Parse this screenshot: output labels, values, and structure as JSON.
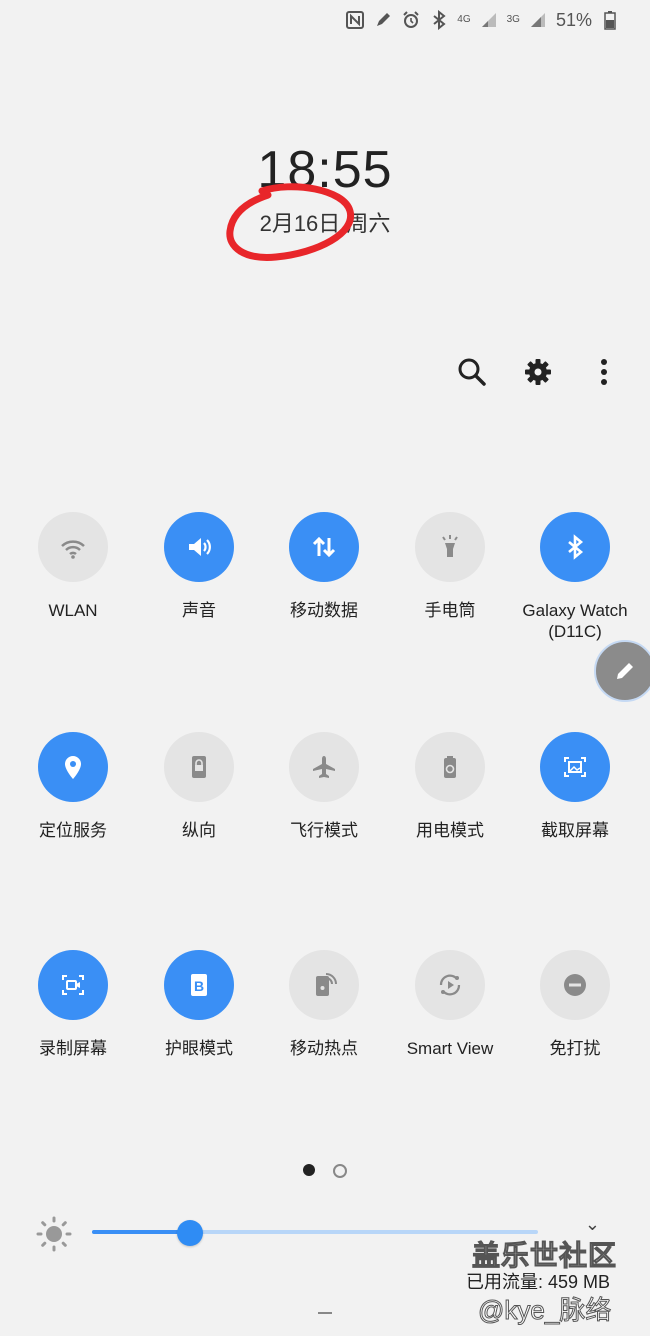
{
  "status_bar": {
    "icons": [
      "nfc-icon",
      "pen-icon",
      "alarm-icon",
      "bluetooth-icon"
    ],
    "network_1": "4G",
    "network_2": "3G",
    "battery_percent": "51%"
  },
  "lockscreen": {
    "time": "18:55",
    "date": "2月16日 周六"
  },
  "actions": [
    "search-icon",
    "gear-icon",
    "more-vert-icon"
  ],
  "tiles": [
    {
      "label": "WLAN",
      "on": false,
      "icon": "wifi-icon"
    },
    {
      "label": "声音",
      "on": true,
      "icon": "volume-icon"
    },
    {
      "label": "移动数据",
      "on": true,
      "icon": "mobile-data-icon"
    },
    {
      "label": "手电筒",
      "on": false,
      "icon": "flashlight-icon"
    },
    {
      "label": "Galaxy Watch\n(D11C)",
      "on": true,
      "icon": "bluetooth-icon"
    },
    {
      "label": "定位服务",
      "on": true,
      "icon": "location-icon"
    },
    {
      "label": "纵向",
      "on": false,
      "icon": "portrait-lock-icon"
    },
    {
      "label": "飞行模式",
      "on": false,
      "icon": "airplane-icon"
    },
    {
      "label": "用电模式",
      "on": false,
      "icon": "power-mode-icon"
    },
    {
      "label": "截取屏幕",
      "on": true,
      "icon": "screenshot-icon"
    },
    {
      "label": "录制屏幕",
      "on": true,
      "icon": "screen-record-icon"
    },
    {
      "label": "护眼模式",
      "on": true,
      "icon": "eye-comfort-icon"
    },
    {
      "label": "移动热点",
      "on": false,
      "icon": "hotspot-icon"
    },
    {
      "label": "Smart View",
      "on": false,
      "icon": "smart-view-icon"
    },
    {
      "label": "免打扰",
      "on": false,
      "icon": "do-not-disturb-icon"
    }
  ],
  "page_indicator": {
    "count": 2,
    "current": 1
  },
  "brightness": {
    "level": 0.22
  },
  "watermark": {
    "site": "盖乐世社区",
    "data_usage": "已用流量: 459 MB",
    "user": "@kye_脉络"
  },
  "colors": {
    "accent": "#3a8ff5",
    "tile_off": "#e4e4e4",
    "annotation": "#e8262a"
  }
}
